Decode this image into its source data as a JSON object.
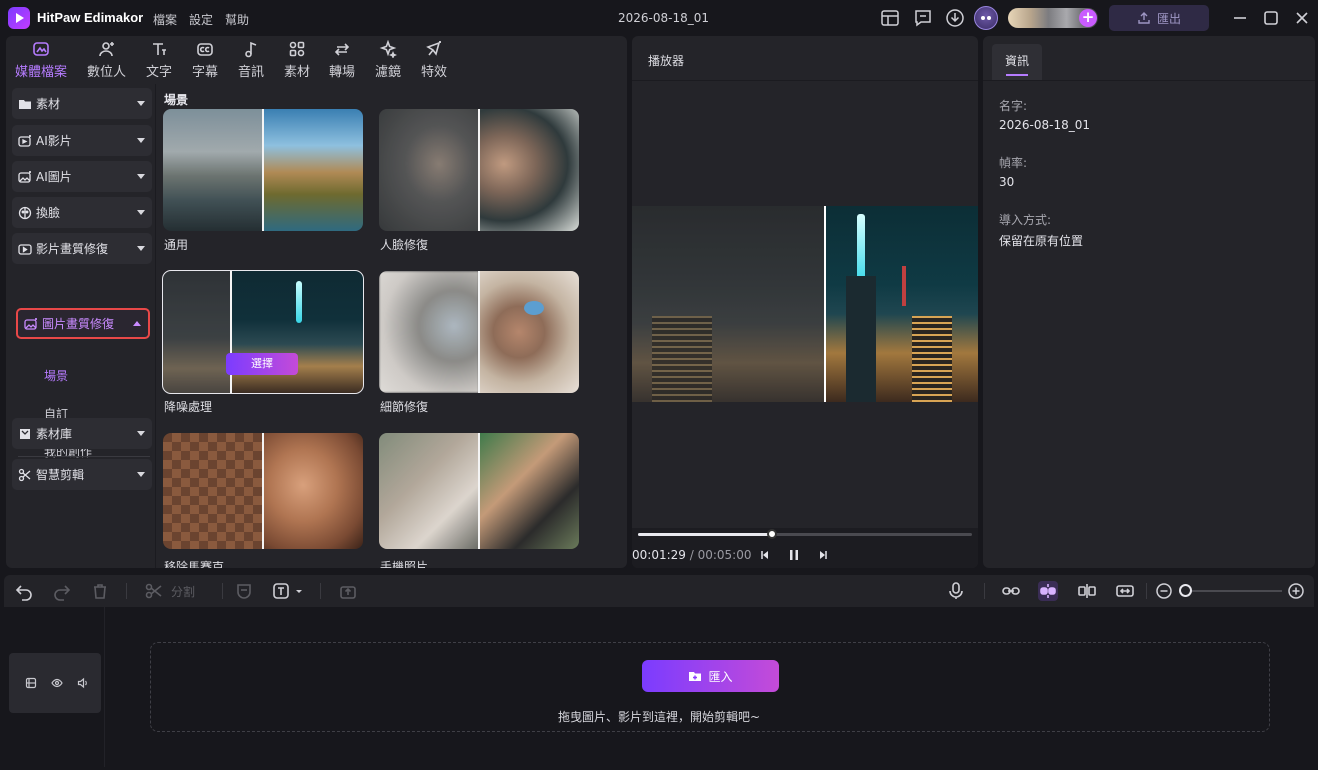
{
  "titlebar": {
    "app_name": "HitPaw Edimakor",
    "menus": [
      "檔案",
      "設定",
      "幫助"
    ],
    "project_name": "2026-08-18_01",
    "export_label": "匯出"
  },
  "tools": [
    {
      "label": "媒體檔案",
      "icon": "media-icon",
      "active": true
    },
    {
      "label": "數位人",
      "icon": "avatar-add-icon"
    },
    {
      "label": "文字",
      "icon": "text-icon"
    },
    {
      "label": "字幕",
      "icon": "subtitle-icon"
    },
    {
      "label": "音訊",
      "icon": "music-icon"
    },
    {
      "label": "素材",
      "icon": "assets-icon"
    },
    {
      "label": "轉場",
      "icon": "transition-icon"
    },
    {
      "label": "濾鏡",
      "icon": "sparkle-icon"
    },
    {
      "label": "特效",
      "icon": "effects-icon"
    }
  ],
  "sidebar": {
    "items": [
      {
        "label": "素材"
      },
      {
        "label": "AI影片"
      },
      {
        "label": "AI圖片"
      },
      {
        "label": "換臉"
      },
      {
        "label": "影片畫質修復"
      },
      {
        "label": "圖片畫質修復"
      },
      {
        "label": "素材庫"
      },
      {
        "label": "智慧剪輯"
      }
    ],
    "subitems": [
      "場景",
      "自訂",
      "我的創作"
    ]
  },
  "content": {
    "section_title": "場景",
    "cards": [
      {
        "label": "通用"
      },
      {
        "label": "人臉修復"
      },
      {
        "label": "降噪處理"
      },
      {
        "label": "細節修復"
      },
      {
        "label": "移除馬賽克"
      },
      {
        "label": "手機照片"
      }
    ],
    "select_label": "選擇"
  },
  "player": {
    "title": "播放器",
    "current_time": "00:01:29",
    "separator": " / ",
    "total_time": "00:05:00",
    "progress": 0.4
  },
  "info": {
    "tab": "資訊",
    "name_label": "名字:",
    "name_value": "2026-08-18_01",
    "fps_label": "幀率:",
    "fps_value": "30",
    "import_label": "導入方式:",
    "import_value": "保留在原有位置"
  },
  "timeline": {
    "split_label": "分割",
    "import_button": "匯入",
    "drop_hint": "拖曳圖片、影片到這裡，開始剪輯吧~",
    "zoom": 0.0
  },
  "colors": {
    "accent": "#b67cff",
    "background": "#17171c",
    "panel": "#242429",
    "highlight_border": "#e84848"
  }
}
